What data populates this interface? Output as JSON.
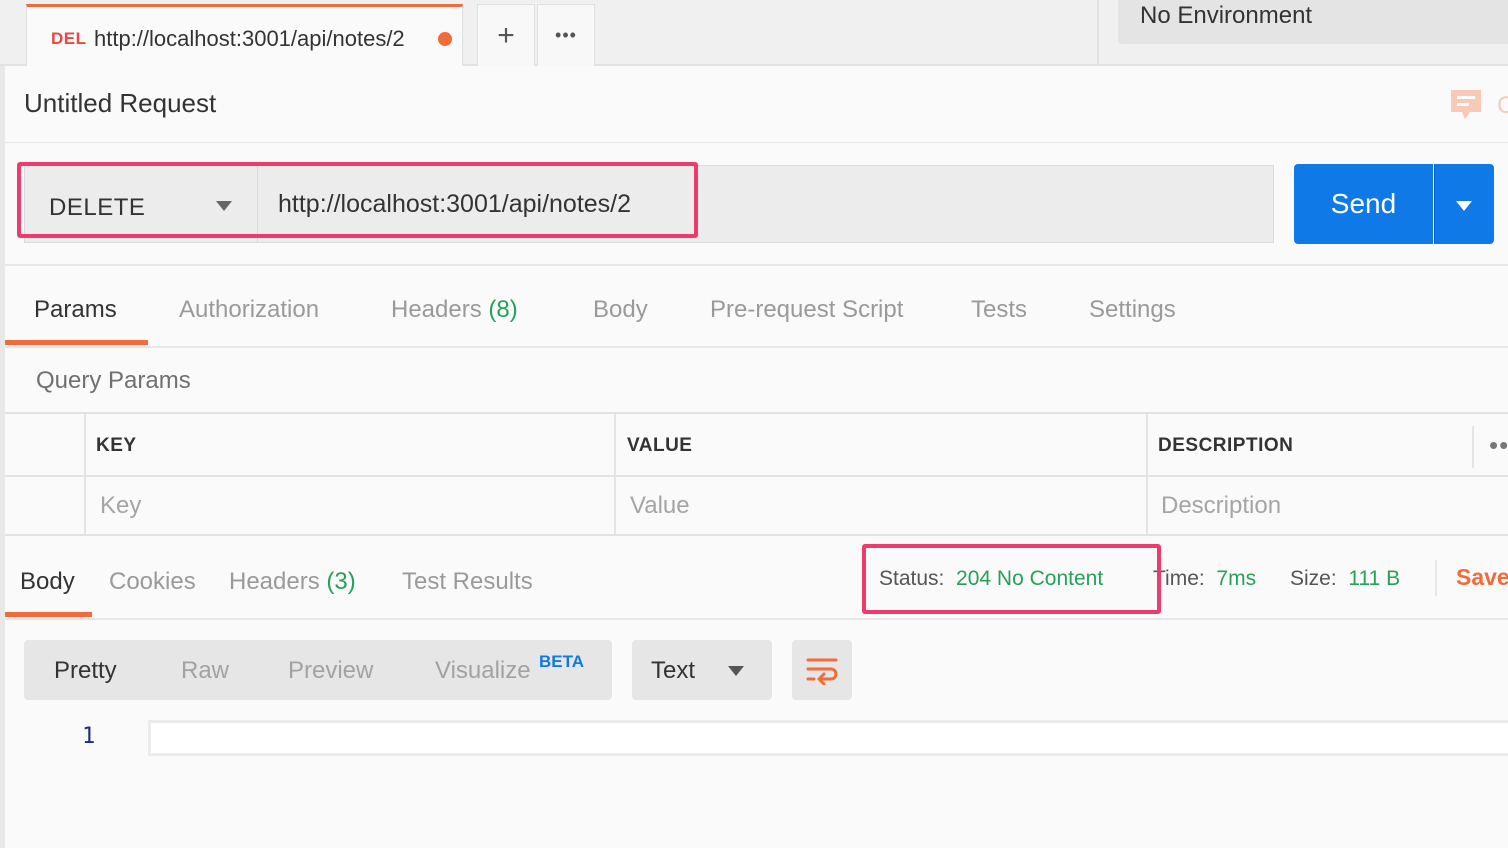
{
  "top_tab": {
    "method_badge": "DEL",
    "url": "http://localhost:3001/api/notes/2",
    "add_tab_label": "+",
    "more_tabs_label": "•••"
  },
  "environment": {
    "label": "No Environment"
  },
  "request": {
    "title": "Untitled Request",
    "comment_icon_partial_text": "C",
    "method": "DELETE",
    "url": "http://localhost:3001/api/notes/2",
    "send_label": "Send"
  },
  "request_tabs": [
    {
      "label": "Params",
      "count": ""
    },
    {
      "label": "Authorization",
      "count": ""
    },
    {
      "label": "Headers",
      "count": "(8)"
    },
    {
      "label": "Body",
      "count": ""
    },
    {
      "label": "Pre-request Script",
      "count": ""
    },
    {
      "label": "Tests",
      "count": ""
    },
    {
      "label": "Settings",
      "count": ""
    }
  ],
  "query_params": {
    "title": "Query Params",
    "columns": [
      "KEY",
      "VALUE",
      "DESCRIPTION"
    ],
    "more_label": "••",
    "placeholders": {
      "key": "Key",
      "value": "Value",
      "description": "Description"
    }
  },
  "response_tabs": [
    {
      "label": "Body",
      "count": ""
    },
    {
      "label": "Cookies",
      "count": ""
    },
    {
      "label": "Headers",
      "count": "(3)"
    },
    {
      "label": "Test Results",
      "count": ""
    }
  ],
  "response_meta": {
    "status_label": "Status:",
    "status_value": "204 No Content",
    "time_label": "Time:",
    "time_value": "7ms",
    "size_label": "Size:",
    "size_value": "111 B",
    "save_label": "Save"
  },
  "view_modes": {
    "pretty": "Pretty",
    "raw": "Raw",
    "preview": "Preview",
    "visualize": "Visualize",
    "beta_badge": "BETA"
  },
  "format": {
    "selected": "Text"
  },
  "editor": {
    "line_number": "1",
    "content": ""
  },
  "colors": {
    "accent": "#f26b3a",
    "send_blue": "#0f79e8",
    "success_green": "#26a15a",
    "annotation_pink": "#ee3b6e",
    "method_red": "#e8483f"
  },
  "icons": {
    "comment": "comment-icon",
    "wrap": "wrap-lines-icon",
    "method_dropdown": "caret-down-icon"
  }
}
